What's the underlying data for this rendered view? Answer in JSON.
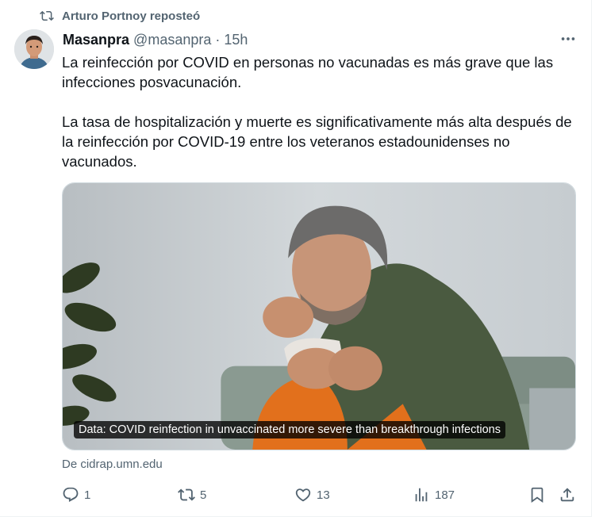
{
  "repost": {
    "icon": "repost-icon",
    "text": "Arturo Portnoy reposteó"
  },
  "author": {
    "display_name": "Masanpra",
    "handle": "@masanpra",
    "separator": "·",
    "time": "15h"
  },
  "tweet": {
    "paragraph_1": "La reinfección por COVID en personas no vacunadas es más grave que las infecciones posvacunación.",
    "paragraph_2": "La tasa de hospitalización y muerte es significativamente más alta después de la reinfección por COVID-19 entre los veteranos estadounidenses no vacunados."
  },
  "media": {
    "caption": "Data: COVID reinfection in unvaccinated more severe than breakthrough infections"
  },
  "source": "De cidrap.umn.edu",
  "actions": {
    "replies": "1",
    "reposts": "5",
    "likes": "13",
    "views": "187"
  },
  "colors": {
    "text_primary": "#0f1419",
    "text_secondary": "#536471",
    "border": "#cfd9de"
  }
}
